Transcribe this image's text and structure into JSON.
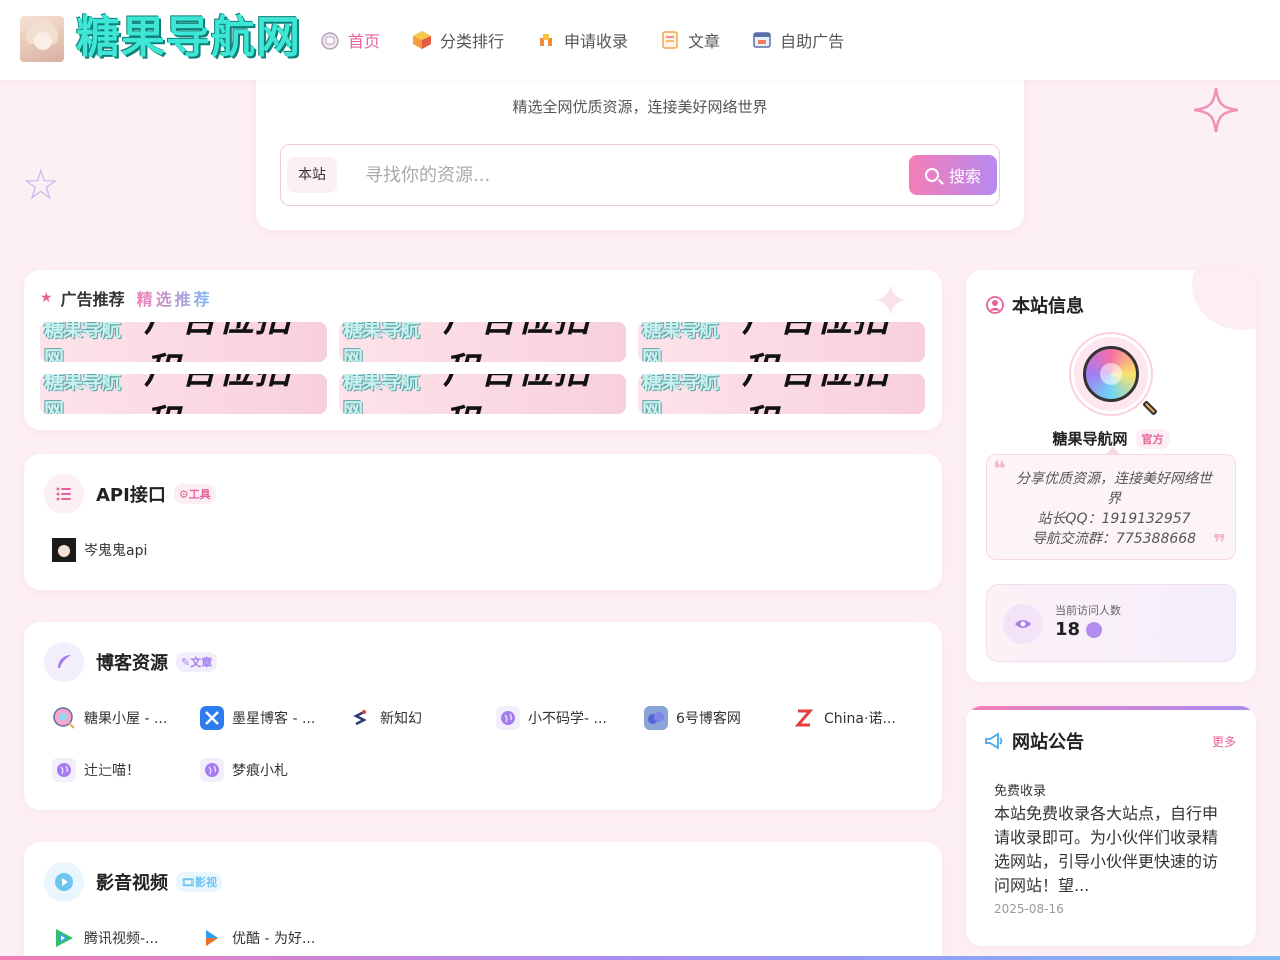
{
  "header": {
    "logo_text": "糖果导航网",
    "nav": [
      {
        "label": "首页",
        "icon": "home-icon",
        "active": true
      },
      {
        "label": "分类排行",
        "icon": "category-icon",
        "active": false
      },
      {
        "label": "申请收录",
        "icon": "apply-icon",
        "active": false
      },
      {
        "label": "文章",
        "icon": "article-icon",
        "active": false
      },
      {
        "label": "自助广告",
        "icon": "ad-icon",
        "active": false
      }
    ]
  },
  "search": {
    "subtitle": "精选全网优质资源，连接美好网络世界",
    "scope": "本站",
    "placeholder": "寻找你的资源...",
    "button": "搜索"
  },
  "ads": {
    "title": "广告推荐",
    "subtitle": "精选推荐",
    "banners": [
      {
        "brand": "糖果导航网",
        "text": "广告位招租"
      },
      {
        "brand": "糖果导航网",
        "text": "广告位招租"
      },
      {
        "brand": "糖果导航网",
        "text": "广告位招租"
      },
      {
        "brand": "糖果导航网",
        "text": "广告位招租"
      },
      {
        "brand": "糖果导航网",
        "text": "广告位招租"
      },
      {
        "brand": "糖果导航网",
        "text": "广告位招租"
      }
    ]
  },
  "sections": {
    "api": {
      "title": "API接口",
      "badge": "⚙工具",
      "sites": [
        {
          "label": "岑鬼鬼api",
          "icon": "anime-avatar-icon"
        }
      ]
    },
    "blog": {
      "title": "博客资源",
      "badge": "✎文章",
      "sites": [
        {
          "label": "糖果小屋 - ...",
          "icon": "candy-icon"
        },
        {
          "label": "墨星博客 - ...",
          "icon": "cross-logo-icon"
        },
        {
          "label": "新知幻",
          "icon": "s-logo-icon"
        },
        {
          "label": "小不码学- ...",
          "icon": "globe-icon"
        },
        {
          "label": "6号博客网",
          "icon": "cloud-logo-icon"
        },
        {
          "label": "China·诺...",
          "icon": "z-logo-icon"
        },
        {
          "label": "辻辷喵！",
          "icon": "globe-icon"
        },
        {
          "label": "梦痕小札",
          "icon": "globe-icon"
        }
      ]
    },
    "video": {
      "title": "影音视频",
      "badge": "🎞影视",
      "sites": [
        {
          "label": "腾讯视频-...",
          "icon": "tencent-video-icon"
        },
        {
          "label": "优酷 - 为好...",
          "icon": "youku-icon"
        }
      ]
    }
  },
  "sidebar": {
    "info": {
      "title": "本站信息",
      "name": "糖果导航网",
      "tag": "官方",
      "quote_line1": "分享优质资源，连接美好网络世界",
      "quote_line2": "站长QQ：1919132957",
      "quote_line3": "导航交流群：775388668",
      "visitor_label": "当前访问人数",
      "visitor_count": "18"
    },
    "notice": {
      "title": "网站公告",
      "more": "更多",
      "item_title": "免费收录",
      "item_body": "本站免费收录各大站点，自行申请收录即可。为小伙伴们收录精选网站，引导小伙伴更快速的访问网站！望...",
      "item_date": "2025-08-16"
    }
  },
  "colors": {
    "accent": "#e6639b",
    "background": "#fdf0f5",
    "gradient_start": "#f47eb6",
    "gradient_end": "#b889f1"
  }
}
